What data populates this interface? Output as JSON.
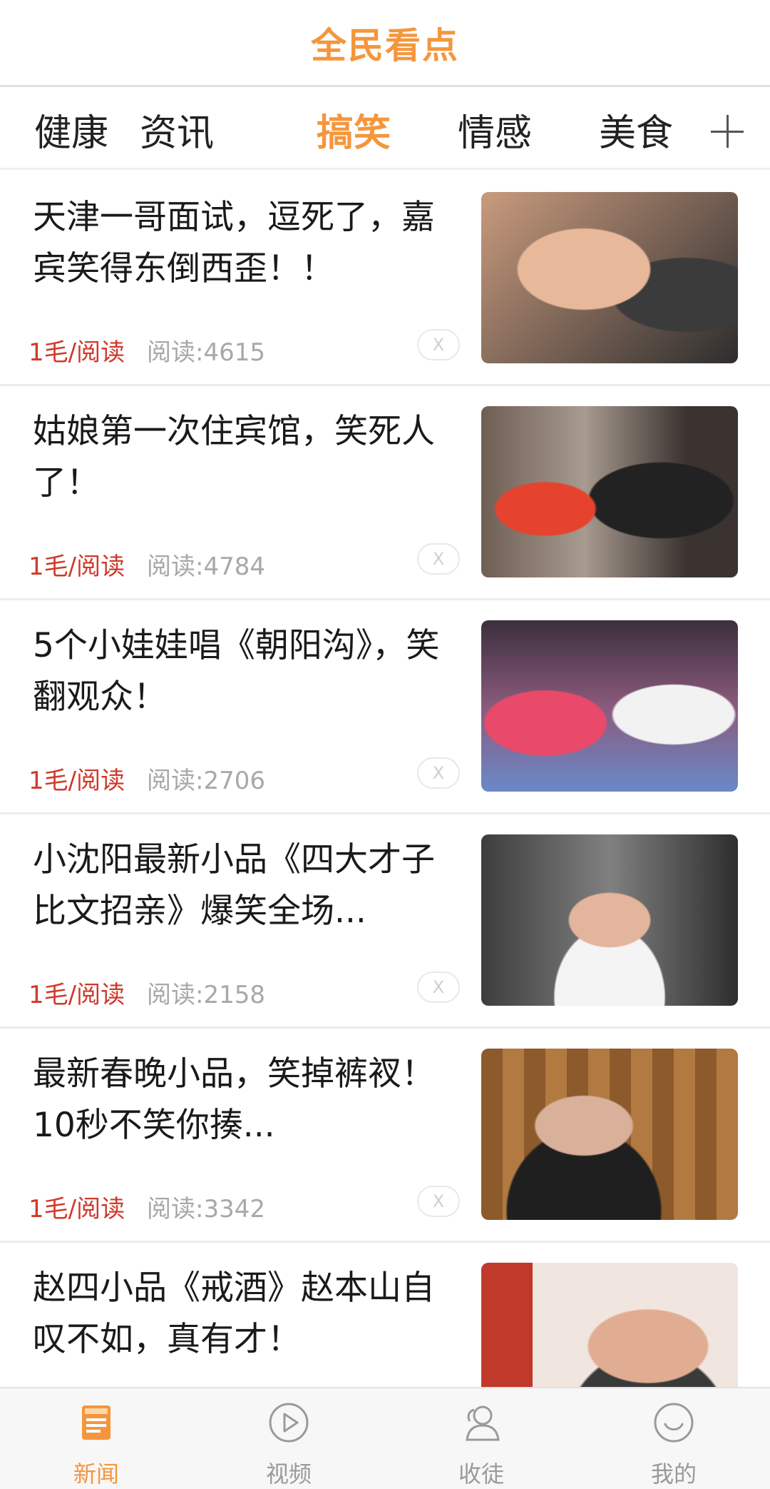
{
  "header": {
    "title": "全民看点"
  },
  "tabs": [
    {
      "label": "健康",
      "active": false
    },
    {
      "label": "资讯",
      "active": false
    },
    {
      "label": "搞笑",
      "active": true
    },
    {
      "label": "情感",
      "active": false
    },
    {
      "label": "美食",
      "active": false
    }
  ],
  "feed": [
    {
      "title": "天津一哥面试，逗死了，嘉宾笑得东倒西歪！！",
      "reward": "1毛/阅读",
      "reads": "阅读:4615",
      "close": "X"
    },
    {
      "title": "姑娘第一次住宾馆，笑死人了！",
      "reward": "1毛/阅读",
      "reads": "阅读:4784",
      "close": "X"
    },
    {
      "title": "5个小娃娃唱《朝阳沟》，笑翻观众！",
      "reward": "1毛/阅读",
      "reads": "阅读:2706",
      "close": "X"
    },
    {
      "title": "小沈阳最新小品《四大才子比文招亲》爆笑全场...",
      "reward": "1毛/阅读",
      "reads": "阅读:2158",
      "close": "X"
    },
    {
      "title": "最新春晚小品，笑掉裤衩！10秒不笑你揍...",
      "reward": "1毛/阅读",
      "reads": "阅读:3342",
      "close": "X"
    },
    {
      "title": "赵四小品《戒酒》赵本山自叹不如，真有才！",
      "reward": "",
      "reads": "",
      "close": ""
    }
  ],
  "bottom_nav": [
    {
      "label": "新闻",
      "icon": "news-icon",
      "active": true
    },
    {
      "label": "视频",
      "icon": "play-icon",
      "active": false
    },
    {
      "label": "收徒",
      "icon": "user-icon",
      "active": false
    },
    {
      "label": "我的",
      "icon": "smile-icon",
      "active": false
    }
  ],
  "colors": {
    "accent": "#f5963c",
    "reward": "#d0392b",
    "muted": "#a8a8a8"
  }
}
